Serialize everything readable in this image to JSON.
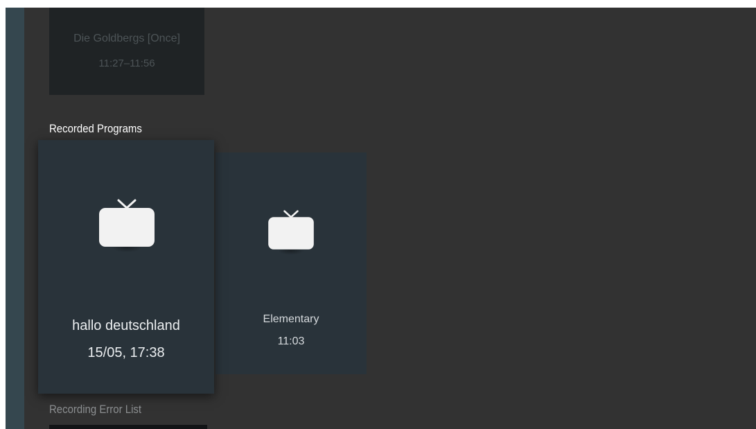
{
  "scheduled": {
    "title": "Die Goldbergs [Once]",
    "time": "11:27–11:56"
  },
  "rows": {
    "recorded_header": "Recorded Programs",
    "error_header": "Recording Error List"
  },
  "recorded_programs": [
    {
      "title": "hallo deutschland",
      "subtitle": "15/05, 17:38",
      "icon": "tv-icon",
      "focused": true
    },
    {
      "title": "Elementary",
      "subtitle": "11:03",
      "icon": "tv-icon",
      "focused": false
    }
  ],
  "colors": {
    "background": "#323232",
    "card": "#29333a",
    "rail": "#35474f"
  }
}
